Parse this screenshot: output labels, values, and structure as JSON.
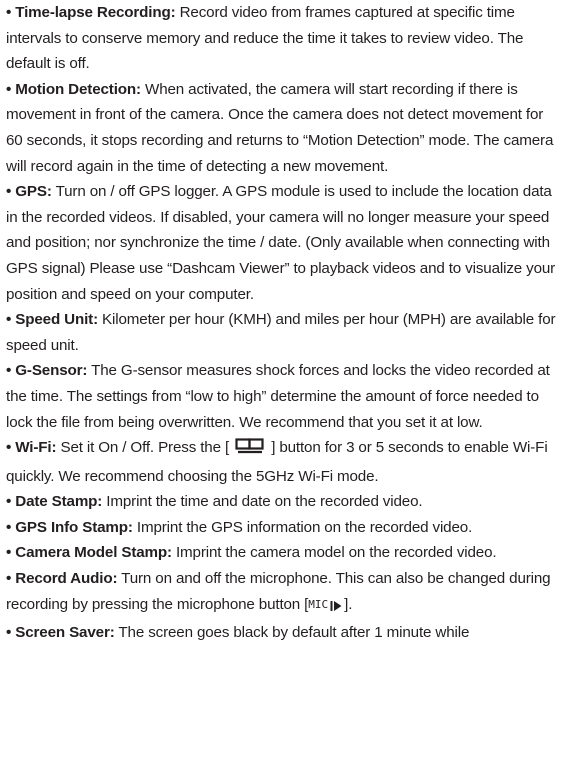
{
  "items": [
    {
      "bullet": "•",
      "term": "Time-lapse Recording:",
      "text": " Record video from frames captured at specific time intervals to conserve memory and reduce the time it takes to review video. The default is off."
    },
    {
      "bullet": "•",
      "term": "Motion Detection:",
      "text": " When activated, the camera will start recording if there is movement in front of the camera. Once the camera does not detect movement for 60 seconds, it stops recording and returns to “Motion Detection” mode. The camera will record again in the time of detecting a new movement."
    },
    {
      "bullet": "•",
      "term": "GPS:",
      "text": " Turn on / off GPS logger. A GPS module is used to include the location data in the recorded videos. If disabled, your camera will no longer measure your speed and position; nor synchronize the time / date. (Only available when connecting with GPS signal) Please use “Dashcam Viewer” to playback videos and to visualize your position and speed on your computer."
    },
    {
      "bullet": "•",
      "term": "Speed Unit:",
      "text": " Kilometer per hour (KMH) and miles per hour (MPH) are available for speed unit."
    },
    {
      "bullet": "•",
      "term": "G-Sensor:",
      "text": " The G-sensor measures shock forces and locks the video recorded at the time. The settings from “low to high” determine the amount of force needed to lock the file from being overwritten. We recommend that you set it at low."
    },
    {
      "bullet": "•",
      "term": "Wi-Fi:",
      "text_before": " Set it On / Off. Press the [",
      "icon": "screen-button-icon",
      "text_after": "] button for 3 or 5 seconds to enable Wi-Fi quickly. We recommend choosing the 5GHz Wi-Fi mode."
    },
    {
      "bullet": "•",
      "term": "Date Stamp:",
      "text": " Imprint the time and date on the recorded video."
    },
    {
      "bullet": "•",
      "term": "GPS Info Stamp:",
      "text": " Imprint the GPS information on the recorded video."
    },
    {
      "bullet": "•",
      "term": "Camera Model Stamp:",
      "text": " Imprint the camera model on the recorded video."
    },
    {
      "bullet": "•",
      "term": "Record Audio:",
      "text_before": " Turn on and off the microphone. This can also be changed during recording by pressing the microphone button [",
      "key_label": "MIC",
      "icon": "play-pause-icon",
      "text_after": "]."
    },
    {
      "bullet": "•",
      "term": "Screen Saver:",
      "text": " The screen goes black by default after 1 minute while"
    }
  ]
}
